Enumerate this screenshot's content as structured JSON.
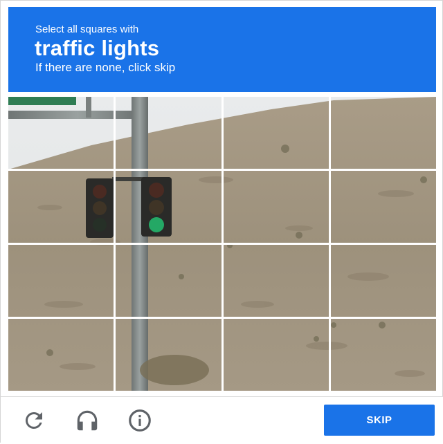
{
  "challenge": {
    "instruction": "Select all squares with",
    "target": "traffic lights",
    "hint": "If there are none, click skip"
  },
  "grid": {
    "rows": 4,
    "cols": 4,
    "tiles": [
      {
        "id": "r1c1",
        "selected": false
      },
      {
        "id": "r1c2",
        "selected": false
      },
      {
        "id": "r1c3",
        "selected": false
      },
      {
        "id": "r1c4",
        "selected": false
      },
      {
        "id": "r2c1",
        "selected": false
      },
      {
        "id": "r2c2",
        "selected": false
      },
      {
        "id": "r2c3",
        "selected": false
      },
      {
        "id": "r2c4",
        "selected": false
      },
      {
        "id": "r3c1",
        "selected": false
      },
      {
        "id": "r3c2",
        "selected": false
      },
      {
        "id": "r3c3",
        "selected": false
      },
      {
        "id": "r3c4",
        "selected": false
      },
      {
        "id": "r4c1",
        "selected": false
      },
      {
        "id": "r4c2",
        "selected": false
      },
      {
        "id": "r4c3",
        "selected": false
      },
      {
        "id": "r4c4",
        "selected": false
      }
    ]
  },
  "footer": {
    "reload_icon": "reload-icon",
    "audio_icon": "headphones-icon",
    "info_icon": "info-icon",
    "skip_label": "SKIP"
  },
  "colors": {
    "accent": "#1a73e8",
    "icon": "#5f6368"
  }
}
